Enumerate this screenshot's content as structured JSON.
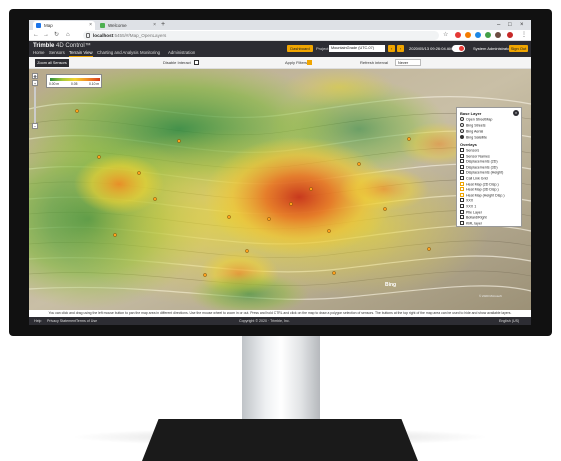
{
  "browser": {
    "tabs": [
      {
        "label": "Map"
      },
      {
        "label": "Welcome"
      }
    ],
    "url_host": "localhost",
    "url_path": ":5455/#/Map_OpenLayers"
  },
  "app": {
    "brand": "Trimble",
    "product": "4D Control™",
    "menu": [
      "Home",
      "Sensors",
      "Terrain View",
      "Charting and Analysis",
      "Monitoring",
      "Administration"
    ],
    "active_menu": "Terrain View",
    "header_button": "Dashboard",
    "project_label": "Project",
    "project_value": "MountainGrade (UTC-07)",
    "datetime": "2020/05/13 09:26:04 AM",
    "user": "System Administrator (Admin)",
    "signout": "Sign Out"
  },
  "toolbar": {
    "zoom_button": "Zoom all Sensors",
    "disable_label": "Disable Interact",
    "filter_label": "Apply Filters",
    "refresh_label": "Refresh interval",
    "refresh_value": "Never"
  },
  "legend": {
    "ticks": [
      "0.00 m",
      "0.05",
      "0.10 m"
    ],
    "colors": [
      "#2e8b3d",
      "#a6c93a",
      "#f2d331",
      "#f08a24",
      "#d63a1a"
    ]
  },
  "layers_panel": {
    "base_title": "Base Layer",
    "base_layers": [
      {
        "label": "Open StreetMap",
        "selected": false
      },
      {
        "label": "Bing Streets",
        "selected": false
      },
      {
        "label": "Bing Aerial",
        "selected": false
      },
      {
        "label": "Bing Satellite",
        "selected": true
      }
    ],
    "overlays_title": "Overlays",
    "overlays": [
      {
        "label": "Sensors",
        "checked": false
      },
      {
        "label": "Sensor Names",
        "checked": false
      },
      {
        "label": "Displacements (2D)",
        "checked": false
      },
      {
        "label": "Displacements (3D)",
        "checked": false
      },
      {
        "label": "Displacements (Height)",
        "checked": false
      },
      {
        "label": "Call Link Grid",
        "checked": false
      },
      {
        "label": "Heat Map (2D Disp.)",
        "checked": false,
        "heat": true
      },
      {
        "label": "Heat Map (3D Disp.)",
        "checked": false,
        "heat": true
      },
      {
        "label": "Heat Map (Height Disp.)",
        "checked": false,
        "heat": true
      },
      {
        "label": "XXX",
        "checked": false
      },
      {
        "label": "XXX 1",
        "checked": false
      },
      {
        "label": "Pile Layer",
        "checked": false
      },
      {
        "label": "Bollard/Right",
        "checked": false
      },
      {
        "label": "KML layer",
        "checked": false
      }
    ]
  },
  "map": {
    "provider": "Bing",
    "copyright": "© 2020 Microsoft"
  },
  "hint": "You can click and drag using the left mouse button to pan the map area in different directions. Use the mouse wheel to zoom in or out. Press and hold CTRL and click on the map to draw a polygon selection of sensors. The buttons at the top right of the map area can be used to hide and show available layers.",
  "footer": {
    "help": "Help",
    "privacy": "Privacy Statement",
    "terms": "Terms of Use",
    "copyright": "Copyright © 2020 · Trimble, Inc.",
    "language": "English (US)"
  }
}
